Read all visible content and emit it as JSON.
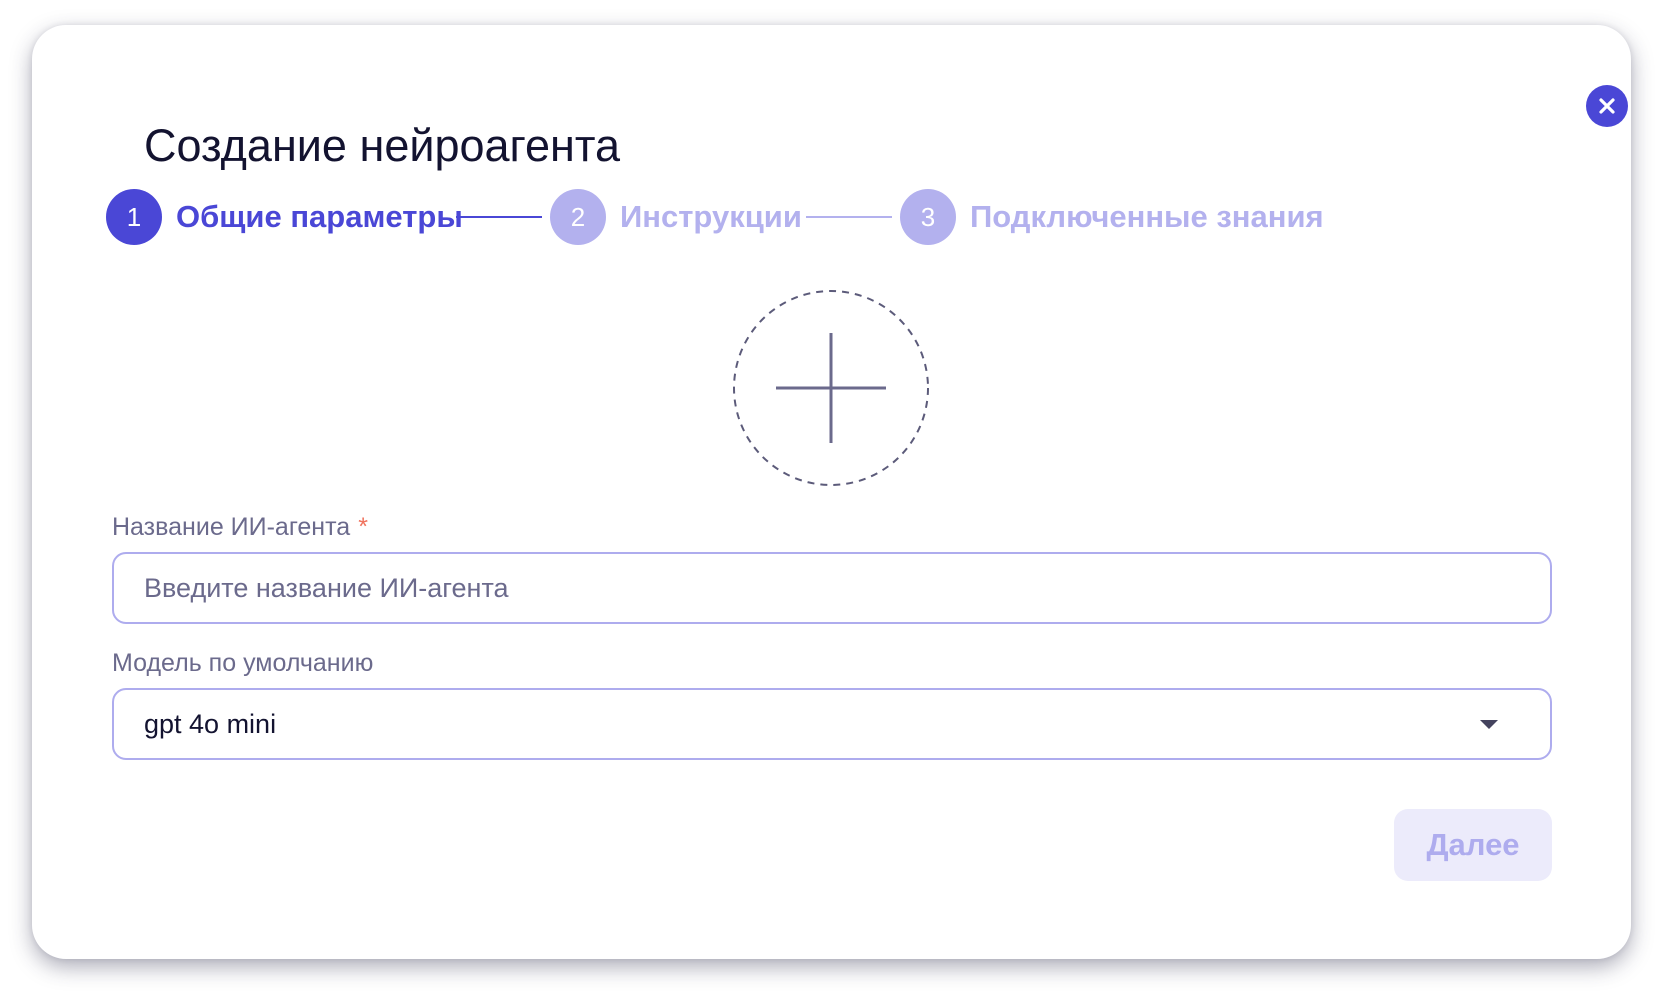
{
  "dialog": {
    "title": "Создание нейроагента",
    "close_icon": "close-icon"
  },
  "stepper": {
    "steps": [
      {
        "number": "1",
        "label": "Общие параметры",
        "state": "active"
      },
      {
        "number": "2",
        "label": "Инструкции",
        "state": "inactive"
      },
      {
        "number": "3",
        "label": "Подключенные знания",
        "state": "inactive"
      }
    ]
  },
  "avatar_upload": {
    "icon": "plus-icon"
  },
  "form": {
    "name_field": {
      "label": "Название ИИ-агента",
      "required_mark": "*",
      "value": "",
      "placeholder": "Введите название ИИ-агента"
    },
    "model_field": {
      "label": "Модель по умолчанию",
      "selected": "gpt 4o mini",
      "icon": "chevron-down-icon"
    }
  },
  "actions": {
    "next_label": "Далее"
  },
  "colors": {
    "accent": "#4a47d6",
    "accent_inactive": "#b3b1ee",
    "required": "#f0735e",
    "text_primary": "#131330",
    "text_secondary": "#6b6a8c",
    "button_disabled_bg": "#ecebfb"
  }
}
